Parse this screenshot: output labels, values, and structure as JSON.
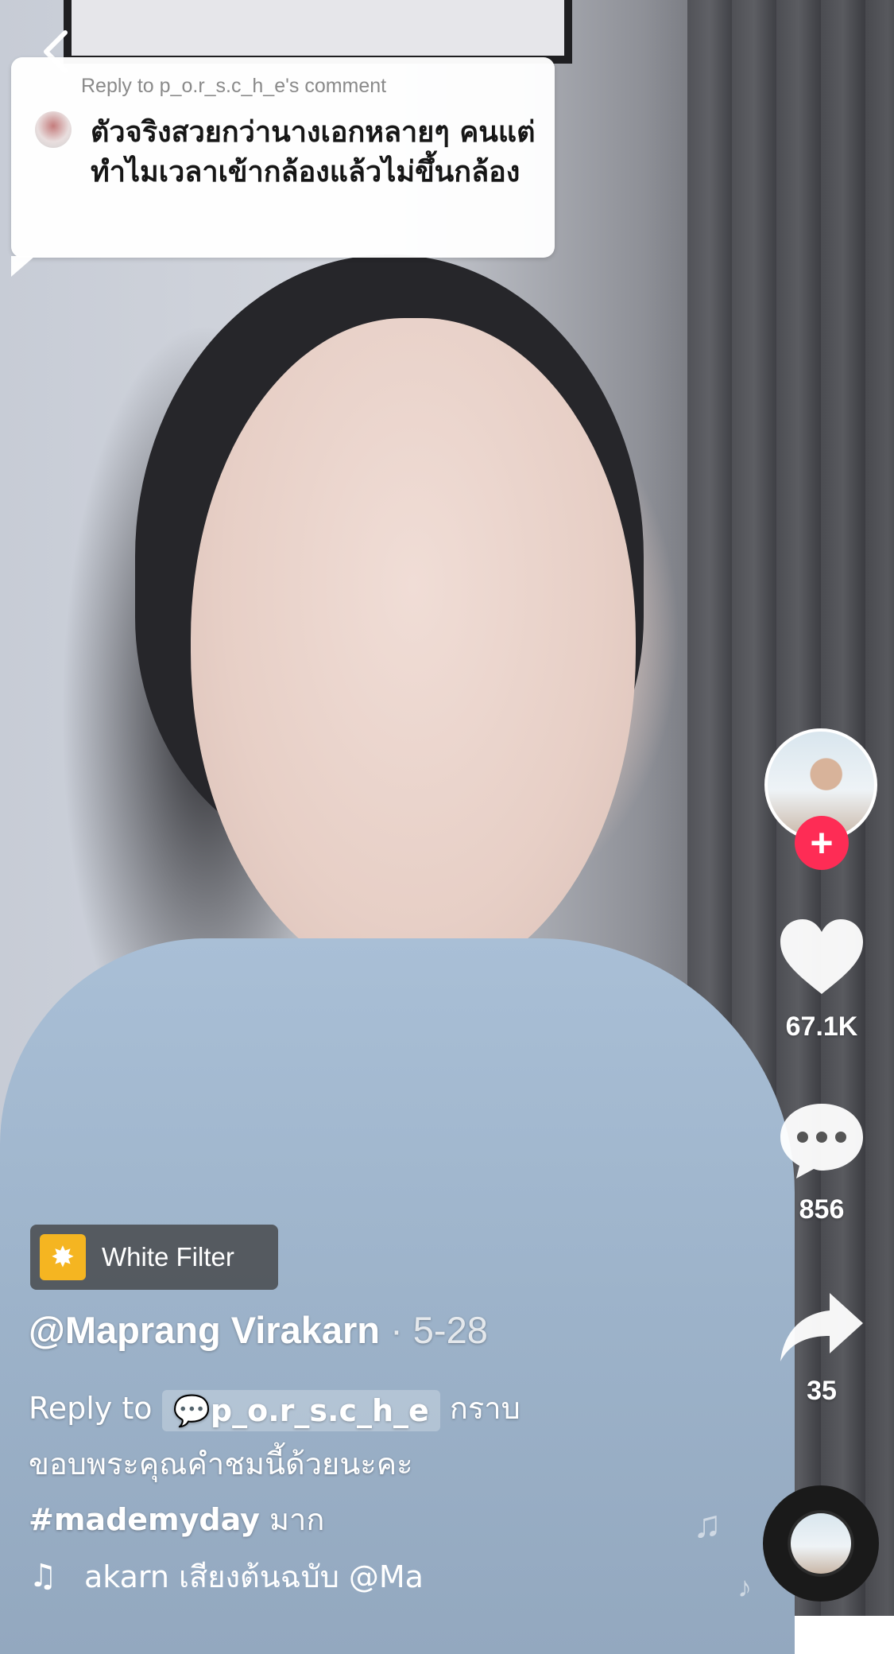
{
  "reply_card": {
    "header": "Reply to p_o.r_s.c_h_e's comment",
    "text": "ตัวจริงสวยกว่านางเอกหลายๆ คนแต่ทำไมเวลาเข้ากล้องแล้วไม่ขึ้นกล้อง"
  },
  "rail": {
    "likes": "67.1K",
    "comments": "856",
    "shares": "35"
  },
  "filter": {
    "label": "White Filter"
  },
  "post": {
    "username": "@Maprang Virakarn",
    "date": "· 5-28",
    "reply_prefix": "Reply to",
    "reply_user": "p_o.r_s.c_h_e",
    "caption_rest": "กราบ ขอบพระคุณคำชมนี้ด้วยนะคะ",
    "hashtag": "#mademyday",
    "caption_end": "มาก"
  },
  "music": {
    "text": "akarn เสียงต้นฉบับ    @Ma"
  },
  "colors": {
    "follow": "#fe2c55",
    "filter_icon": "#f5b521"
  }
}
